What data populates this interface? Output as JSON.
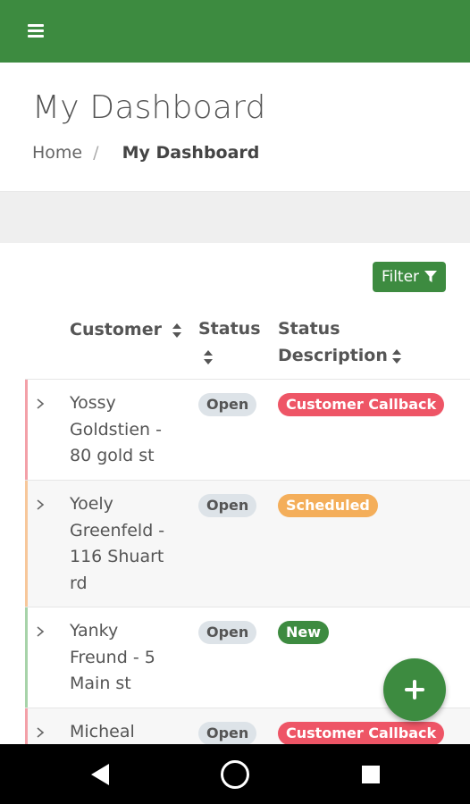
{
  "header": {
    "title": "My Dashboard",
    "icon": "hamburger-menu-icon"
  },
  "breadcrumb": {
    "home": "Home",
    "separator": "/",
    "current": "My Dashboard"
  },
  "toolbar": {
    "filter_label": "Filter",
    "filter_icon": "funnel-icon"
  },
  "table": {
    "columns": {
      "customer": "Customer",
      "status": "Status",
      "status_desc_line1": "Status",
      "status_desc_line2": "Description"
    },
    "rows": [
      {
        "customer": "Yossy Goldstien - 80 gold st",
        "status": "Open",
        "description": "Customer Callback",
        "description_color": "#ee5566",
        "accent_color": "#f3a0a8"
      },
      {
        "customer": "Yoely Greenfeld - 116 Shuart rd",
        "status": "Open",
        "description": "Scheduled",
        "description_color": "#f4ae5a",
        "accent_color": "#f7c79a"
      },
      {
        "customer": "Yanky Freund - 5 Main st",
        "status": "Open",
        "description": "New",
        "description_color": "#3d8b40",
        "accent_color": "#a7d3a9"
      },
      {
        "customer": "Micheal",
        "status": "Open",
        "description": "Customer Callback",
        "description_color": "#ee5566",
        "accent_color": "#f3a0a8"
      }
    ]
  },
  "fab": {
    "icon": "plus-icon"
  },
  "colors": {
    "primary": "#3d8b40",
    "danger": "#ee5566",
    "warning": "#f4ae5a",
    "neutral_badge": "#dde3e8"
  }
}
